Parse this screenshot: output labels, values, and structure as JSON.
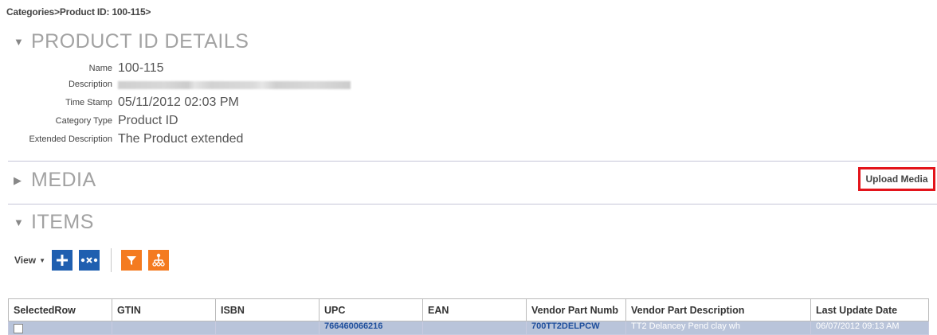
{
  "breadcrumb": {
    "root": "Categories",
    "sep1": ">",
    "current": "Product ID: 100-115",
    "sep2": ">"
  },
  "product_section": {
    "title": "PRODUCT ID DETAILS"
  },
  "details": [
    {
      "label": "Name",
      "value": "100-115"
    },
    {
      "label": "Description",
      "value": ""
    },
    {
      "label": "Time Stamp",
      "value": "05/11/2012 02:03 PM"
    },
    {
      "label": "Category Type",
      "value": "Product ID"
    },
    {
      "label": "Extended Description",
      "value": "The Product extended"
    }
  ],
  "media_section": {
    "title": "MEDIA",
    "upload_label": "Upload Media"
  },
  "items_section": {
    "title": "ITEMS",
    "view_label": "View"
  },
  "table": {
    "headers": [
      "SelectedRow",
      "GTIN",
      "ISBN",
      "UPC",
      "EAN",
      "Vendor Part Numb",
      "Vendor Part Description",
      "Last Update Date"
    ],
    "rows": [
      {
        "gtin": "",
        "isbn": "",
        "upc": "766460066216",
        "ean": "",
        "vendor_part_number": "700TT2DELPCW",
        "vendor_part_description": "TT2 Delancey Pend clay wh",
        "last_update": "06/07/2012 09:13 AM"
      }
    ]
  },
  "colors": {
    "accent_blue": "#1f5fb0",
    "accent_orange": "#f47b20",
    "highlight_red": "#e3141b",
    "row_bg": "#b9c4da"
  },
  "icons": {
    "expand": "triangle-down-icon",
    "collapsed": "triangle-right-icon",
    "add": "plus-icon",
    "columns": "dot-x-dot-icon",
    "filter": "filter-icon",
    "hierarchy": "hierarchy-icon"
  }
}
